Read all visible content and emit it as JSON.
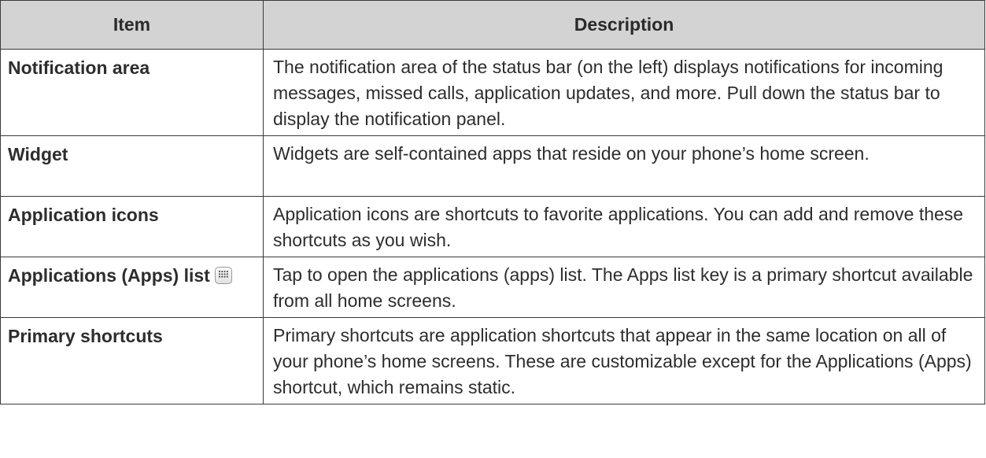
{
  "table": {
    "headers": {
      "item": "Item",
      "description": "Description"
    },
    "rows": [
      {
        "item": "Notification area",
        "description": "The notification area of the status bar (on the left) displays notifications for incoming messages, missed calls, application updates, and more. Pull down the status bar to display the notification panel."
      },
      {
        "item": "Widget",
        "description": "Widgets are self-contained apps that reside on your phone’s home screen."
      },
      {
        "item": "Application icons",
        "description": "Application icons are shortcuts to favorite applications. You can add and remove these shortcuts as you wish."
      },
      {
        "item": "Applications (Apps) list",
        "item_icon": "apps-grid-icon",
        "description": "Tap to open the applications (apps) list. The Apps list key is a primary shortcut available from all home screens."
      },
      {
        "item": "Primary shortcuts",
        "description": "Primary shortcuts are application shortcuts that appear in the same location on all of your phone’s home screens. These are customizable except for the Applications (Apps) shortcut, which remains static."
      }
    ]
  },
  "colors": {
    "header_background": "#d3d3d3",
    "border": "#3a3a3a",
    "text": "#2d2d2d"
  }
}
